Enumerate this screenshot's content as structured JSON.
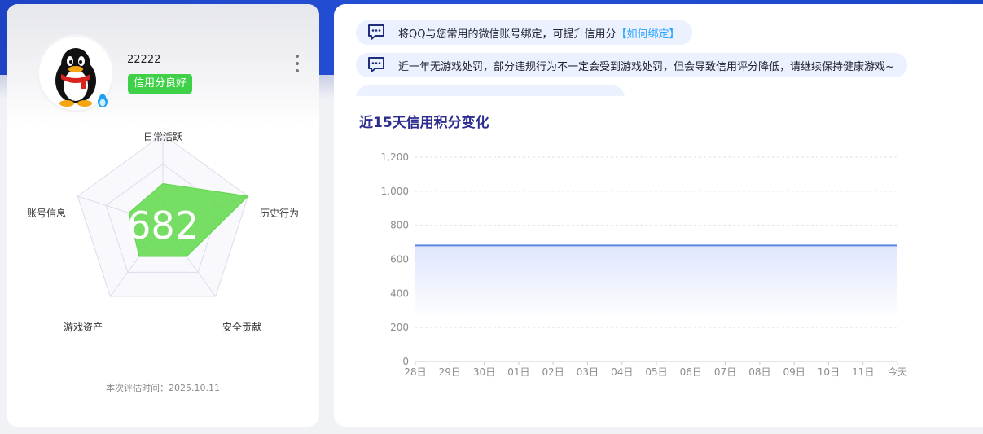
{
  "profile": {
    "username": "22222",
    "credit_badge": "信用分良好",
    "score": "682",
    "eval_time": "本次评估时间：2025.10.11",
    "avatar_icon": "qq-penguin-icon",
    "more_icon": "more-vertical-icon"
  },
  "radar": {
    "labels": [
      "日常活跃",
      "历史行为",
      "安全贡献",
      "游戏资产",
      "账号信息"
    ],
    "values": [
      0.45,
      1.0,
      0.45,
      0.45,
      0.4
    ]
  },
  "notices": [
    {
      "text": "将QQ与您常用的微信账号绑定，可提升信用分",
      "link": "【如何绑定】",
      "icon": "message-icon"
    },
    {
      "text": "近一年无游戏处罚，部分违规行为不一定会受到游戏处罚，但会导致信用评分降低，请继续保持健康游戏~",
      "link": "",
      "icon": "message-icon"
    },
    {
      "text": "",
      "link": "",
      "icon": "message-icon"
    }
  ],
  "chart_data": {
    "type": "area",
    "title": "近15天信用积分变化",
    "categories": [
      "28日",
      "29日",
      "30日",
      "01日",
      "02日",
      "03日",
      "04日",
      "05日",
      "06日",
      "07日",
      "08日",
      "09日",
      "10日",
      "11日",
      "今天"
    ],
    "values": [
      682,
      682,
      682,
      682,
      682,
      682,
      682,
      682,
      682,
      682,
      682,
      682,
      682,
      682,
      682
    ],
    "ylim": [
      0,
      1200
    ],
    "yticks": [
      "0",
      "200",
      "400",
      "600",
      "800",
      "1,000",
      "1,200"
    ],
    "ytick_values": [
      0,
      200,
      400,
      600,
      800,
      1000,
      1200
    ],
    "grid": true,
    "line_color": "#5b86e5",
    "fill_color": "#dfe6fd"
  },
  "colors": {
    "badge": "#3ed147",
    "radar_fill": "#5fd84a",
    "accent": "#2d2d8f",
    "link": "#2aa4ff"
  }
}
